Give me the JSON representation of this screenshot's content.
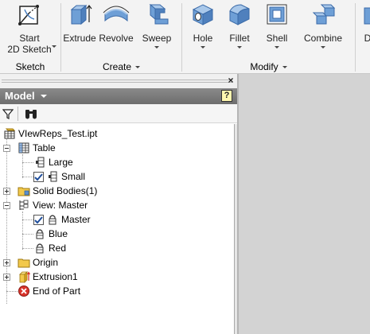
{
  "ribbon": {
    "buttons": {
      "start_sketch": "Start\n2D Sketch",
      "extrude": "Extrude",
      "revolve": "Revolve",
      "sweep": "Sweep",
      "hole": "Hole",
      "fillet": "Fillet",
      "shell": "Shell",
      "combine": "Combine",
      "partial": "D"
    },
    "groups": {
      "sketch": "Sketch",
      "create": "Create",
      "modify": "Modify"
    }
  },
  "browser": {
    "title": "Model",
    "help_label": "?",
    "close_label": "×",
    "tree": [
      {
        "label": "VIewReps_Test.ipt",
        "icon": "part-file-icon"
      },
      {
        "label": "Table",
        "icon": "table-icon"
      },
      {
        "label": "Large",
        "icon": "row-icon"
      },
      {
        "label": "Small",
        "icon": "row-icon",
        "checked": true
      },
      {
        "label": "Solid Bodies(1)",
        "icon": "folder-icon"
      },
      {
        "label": "View: Master",
        "icon": "view-rep-icon"
      },
      {
        "label": "Master",
        "icon": "lock-icon",
        "checked": true
      },
      {
        "label": "Blue",
        "icon": "lock-icon"
      },
      {
        "label": "Red",
        "icon": "lock-icon"
      },
      {
        "label": "Origin",
        "icon": "folder-icon"
      },
      {
        "label": "Extrusion1",
        "icon": "extrusion-icon"
      },
      {
        "label": "End of Part",
        "icon": "end-of-part-icon"
      }
    ]
  },
  "colors": {
    "header_bg": "#7b7b7b",
    "graphics_bg": "#d3d3d3",
    "icon_blue": "#5b8fcf",
    "folder_yellow": "#f2c94c",
    "end_red": "#d9342b"
  }
}
